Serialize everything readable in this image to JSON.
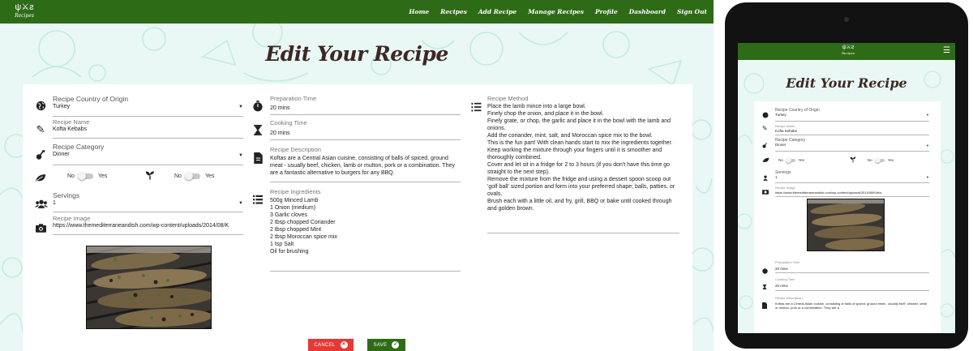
{
  "colors": {
    "nav_bg": "#2e6b17",
    "title": "#3e2723",
    "cancel": "#e53935",
    "save": "#2e6b17",
    "background": "#e9f8f4"
  },
  "brand": {
    "logo_mark": "ψ⚔ƨ",
    "logo_text": "Recipes"
  },
  "nav": {
    "items": [
      "Home",
      "Recipes",
      "Add Recipe",
      "Manage Recipes",
      "Profile",
      "Dashboard",
      "Sign Out"
    ]
  },
  "page": {
    "title": "Edit Your Recipe"
  },
  "form": {
    "country": {
      "label": "Recipe Country of Origin",
      "value": "Turkey",
      "icon": "globe-icon"
    },
    "name": {
      "label": "Recipe Name",
      "value": "Kofta Kebabs",
      "icon": "pencil-icon"
    },
    "category": {
      "label": "Recipe Category",
      "value": "Dinner",
      "icon": "guitar-icon"
    },
    "toggle_veg": {
      "off": "No",
      "on": "Yes",
      "icon": "leaf-icon"
    },
    "toggle_vegan": {
      "off": "No",
      "on": "Yes",
      "icon": "sprout-icon"
    },
    "servings": {
      "label": "Servings",
      "value": "1",
      "icon": "users-icon"
    },
    "image": {
      "label": "Recipe Image",
      "value": "https://www.themediterraneandish.com/wp-content/uploads/2014/08/K",
      "icon": "camera-icon"
    },
    "prep_time": {
      "label": "Preparation Time",
      "value": "20 mins",
      "icon": "stopwatch-icon"
    },
    "cook_time": {
      "label": "Cooking Time",
      "value": "20 mins",
      "icon": "hourglass-icon"
    },
    "description": {
      "label": "Recipe Description",
      "value": "Koftas are a Central Asian cuisine, consisting of balls of spiced, ground meat - usually beef, chicken, lamb or mutton, pork or a combination. They are a fantastic alternative to burgers for any BBQ.",
      "icon": "document-icon"
    },
    "ingredients": {
      "label": "Recipe Ingredients",
      "items": [
        "500g Minced Lamb",
        "1 Onion (medium)",
        "3 Garlic cloves",
        "2 tbsp chopped Coriander",
        "2 tbsp chopped Mint",
        "2 tbsp Moroccan spice mix",
        "1 tsp Salt",
        "Oil for brushing"
      ],
      "icon": "list-icon"
    },
    "method": {
      "label": "Recipe Method",
      "value": "Place the lamb mince into a large bowl.\nFinely chop the onion, and place it in the bowl.\nFinely grate, or chop, the garlic and place it in the bowl with the lamb and onions.\nAdd the coriander, mint, salt, and Moroccan spice mix to the bowl.\nThis is the fun part! With clean hands start to mix the ingredients together. Keep working the mixture through your fingers until it is smoother and thoroughly combined.\nCover and let sit in a fridge for 2 to 3 hours (if you don't have this time go straight to the next step).\nRemove the mixture from the fridge and using a dessert spoon scoop out 'golf ball' sized portion and form into your preferred shape; balls, patties, or ovals.\nBrush each with a little oil, and fry, grill, BBQ or bake until cooked through and golden brown.",
      "icon": "numbered-list-icon"
    }
  },
  "buttons": {
    "cancel": "CANCEL",
    "save": "SAVE"
  },
  "tablet": {
    "title": "Edit Your Recipe",
    "image_value": "https://www.themediterraneandish.com/wp-content/uploads/2014/08/Kofta-",
    "description_preview": "Koftas are a Central Asian cuisine, consisting of balls of spiced, ground meat - usually beef, chicken, lamb or mutton, pork or a combination. They are a"
  }
}
